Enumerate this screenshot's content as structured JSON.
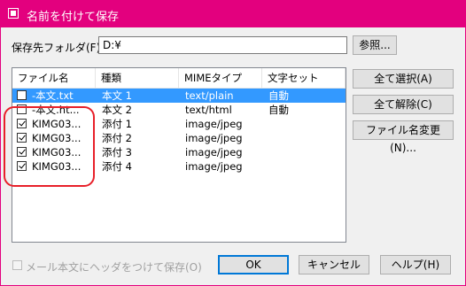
{
  "window": {
    "title": "名前を付けて保存",
    "accent": "#e3007e"
  },
  "folder": {
    "label": "保存先フォルダ(F)",
    "value": "D:¥",
    "browse_label": "参照..."
  },
  "table": {
    "headers": [
      "ファイル名",
      "種類",
      "MIMEタイプ",
      "文字セット"
    ],
    "rows": [
      {
        "checked": false,
        "selected": true,
        "name": "-本文.txt",
        "type": "本文 1",
        "mime": "text/plain",
        "charset": "自動"
      },
      {
        "checked": false,
        "selected": false,
        "name": "-本文.ht...",
        "type": "本文 2",
        "mime": "text/html",
        "charset": "自動"
      },
      {
        "checked": true,
        "selected": false,
        "name": "KIMG03...",
        "type": "添付 1",
        "mime": "image/jpeg",
        "charset": ""
      },
      {
        "checked": true,
        "selected": false,
        "name": "KIMG03...",
        "type": "添付 2",
        "mime": "image/jpeg",
        "charset": ""
      },
      {
        "checked": true,
        "selected": false,
        "name": "KIMG03...",
        "type": "添付 3",
        "mime": "image/jpeg",
        "charset": ""
      },
      {
        "checked": true,
        "selected": false,
        "name": "KIMG03...",
        "type": "添付 4",
        "mime": "image/jpeg",
        "charset": ""
      }
    ]
  },
  "side_buttons": {
    "select_all": "全て選択(A)",
    "deselect_all": "全て解除(C)",
    "rename": "ファイル名変更(N)..."
  },
  "footer": {
    "header_checkbox_label": "メール本文にヘッダをつけて保存(O)",
    "ok": "OK",
    "cancel": "キャンセル",
    "help": "ヘルプ(H)"
  }
}
